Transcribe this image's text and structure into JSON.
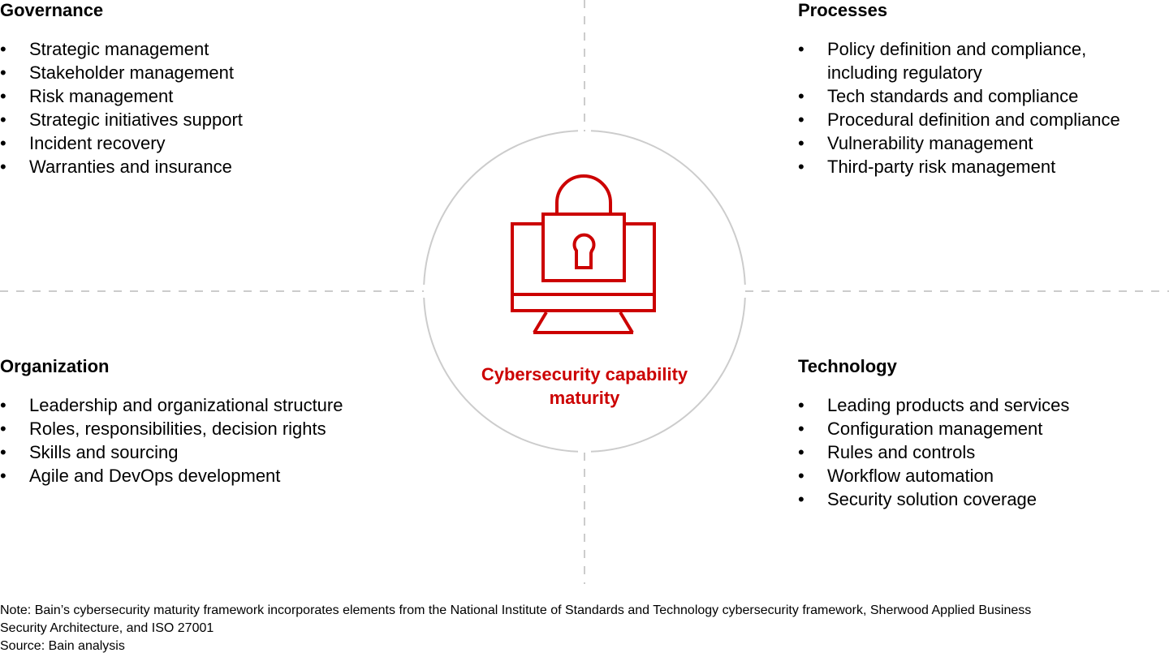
{
  "center": {
    "title": "Cybersecurity capability maturity",
    "icon": "monitor-lock-icon",
    "accent_color": "#cc0000"
  },
  "quadrants": {
    "governance": {
      "title": "Governance",
      "items": [
        "Strategic management",
        "Stakeholder management",
        "Risk management",
        "Strategic initiatives support",
        "Incident recovery",
        "Warranties and insurance"
      ]
    },
    "processes": {
      "title": "Processes",
      "items": [
        "Policy definition and compliance, including regulatory",
        "Tech standards and compliance",
        "Procedural definition and compliance",
        "Vulnerability management",
        "Third-party risk management"
      ]
    },
    "organization": {
      "title": "Organization",
      "items": [
        "Leadership and organizational structure",
        "Roles, responsibilities, decision rights",
        "Skills and sourcing",
        "Agile and DevOps development"
      ]
    },
    "technology": {
      "title": "Technology",
      "items": [
        "Leading products and services",
        "Configuration management",
        "Rules and controls",
        "Workflow automation",
        "Security solution coverage"
      ]
    }
  },
  "bullet": "•",
  "footer": {
    "note_line1": "Note: Bain’s cybersecurity maturity framework incorporates elements from the National Institute of Standards and Technology cybersecurity framework, Sherwood Applied Business",
    "note_line2": "Security Architecture, and ISO 27001",
    "source": "Source: Bain analysis"
  }
}
